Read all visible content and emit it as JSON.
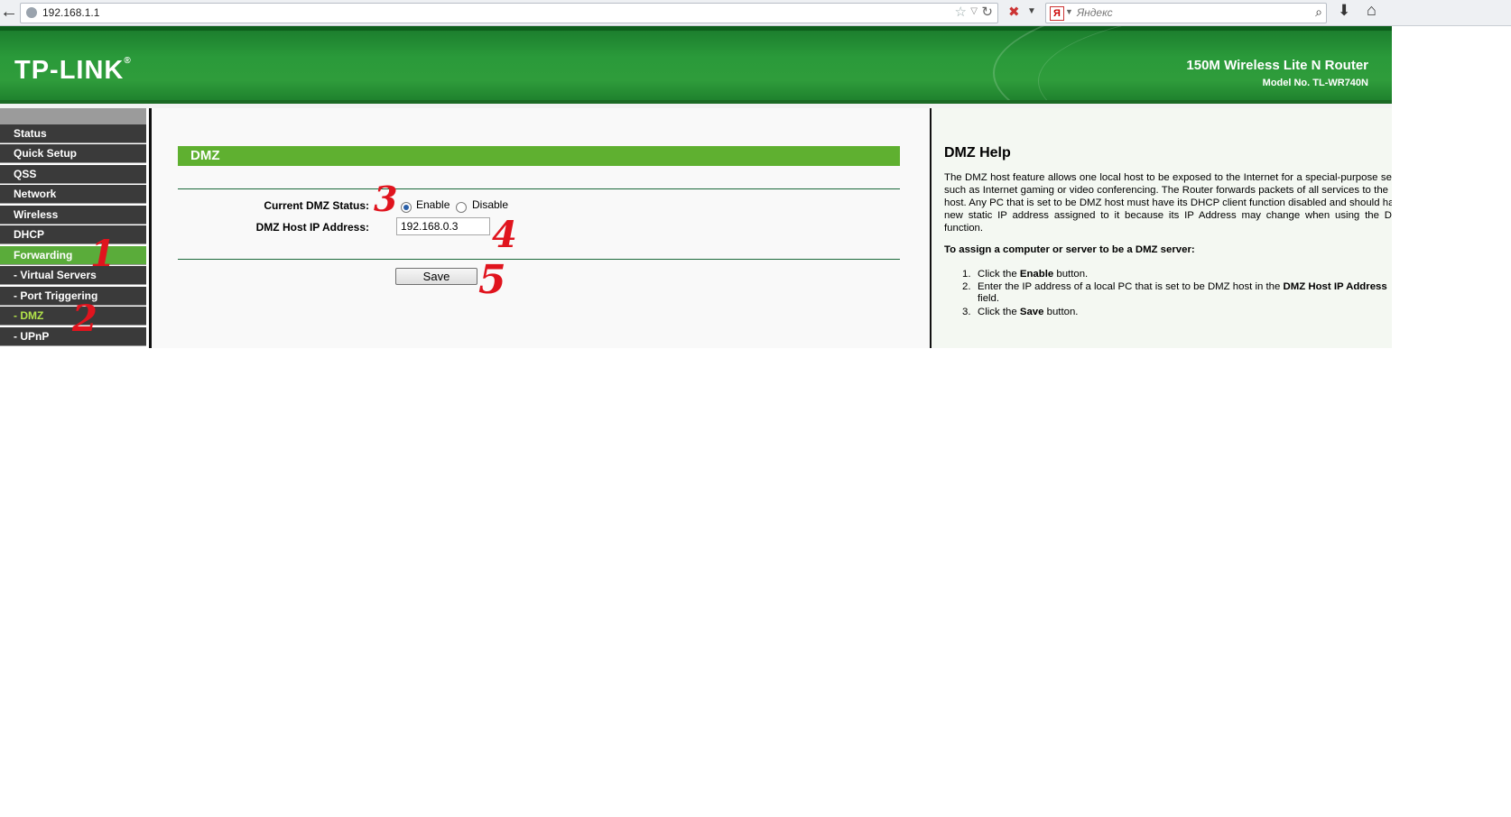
{
  "browser": {
    "url": "192.168.1.1",
    "search_placeholder": "Яндекс",
    "search_engine_glyph": "Я",
    "icons": [
      "back-arrow-icon",
      "globe-icon",
      "bookmark-star-icon",
      "dropdown-icon",
      "reload-icon",
      "addon-icon",
      "yandex-icon",
      "search-icon",
      "download-icon",
      "home-icon"
    ]
  },
  "header": {
    "logo": "TP-LINK",
    "logo_reg": "®",
    "product": "150M Wireless Lite N Router",
    "model": "Model No. TL-WR740N"
  },
  "menu": {
    "items": [
      {
        "label": "Status"
      },
      {
        "label": "Quick Setup"
      },
      {
        "label": "QSS"
      },
      {
        "label": "Network"
      },
      {
        "label": "Wireless"
      },
      {
        "label": "DHCP"
      },
      {
        "label": "Forwarding"
      },
      {
        "label": "- Virtual Servers"
      },
      {
        "label": "- Port Triggering"
      },
      {
        "label": "- DMZ"
      },
      {
        "label": "- UPnP"
      }
    ],
    "active": "Forwarding",
    "current_sub": "- DMZ"
  },
  "dmz": {
    "title": "DMZ",
    "status_label": "Current DMZ Status:",
    "enable_label": "Enable",
    "disable_label": "Disable",
    "status_value": "Enable",
    "host_ip_label": "DMZ Host IP Address:",
    "host_ip_value": "192.168.0.3",
    "save_label": "Save"
  },
  "help": {
    "title": "DMZ Help",
    "paragraph": "The DMZ host feature allows one local host to be exposed to the Internet for a special-purpose service such as Internet gaming or video conferencing. The Router forwards packets of all services to the DMZ host. Any PC that is set to be DMZ host must have its DHCP client function disabled and should have a new static IP address assigned to it because its IP Address may change when using the DHCP function.",
    "subheading": "To assign a computer or server to be a DMZ server:",
    "steps": [
      {
        "num": "1.",
        "pre": "Click the ",
        "bold": "Enable",
        "post": " button."
      },
      {
        "num": "2.",
        "pre": "Enter the IP address of a local PC that is set to be DMZ host in the ",
        "bold": "DMZ Host IP Address",
        "post": "",
        "cont": "field."
      },
      {
        "num": "3.",
        "pre": "Click the ",
        "bold": "Save",
        "post": " button."
      }
    ]
  },
  "annotations": [
    "1",
    "2",
    "3",
    "4",
    "5"
  ],
  "colors": {
    "banner_green": "#2a9a3a",
    "menu_dark": "#3a3a3a",
    "menu_active": "#5aac3a",
    "title_bar": "#5fb030",
    "annotation_red": "#e0141e"
  }
}
